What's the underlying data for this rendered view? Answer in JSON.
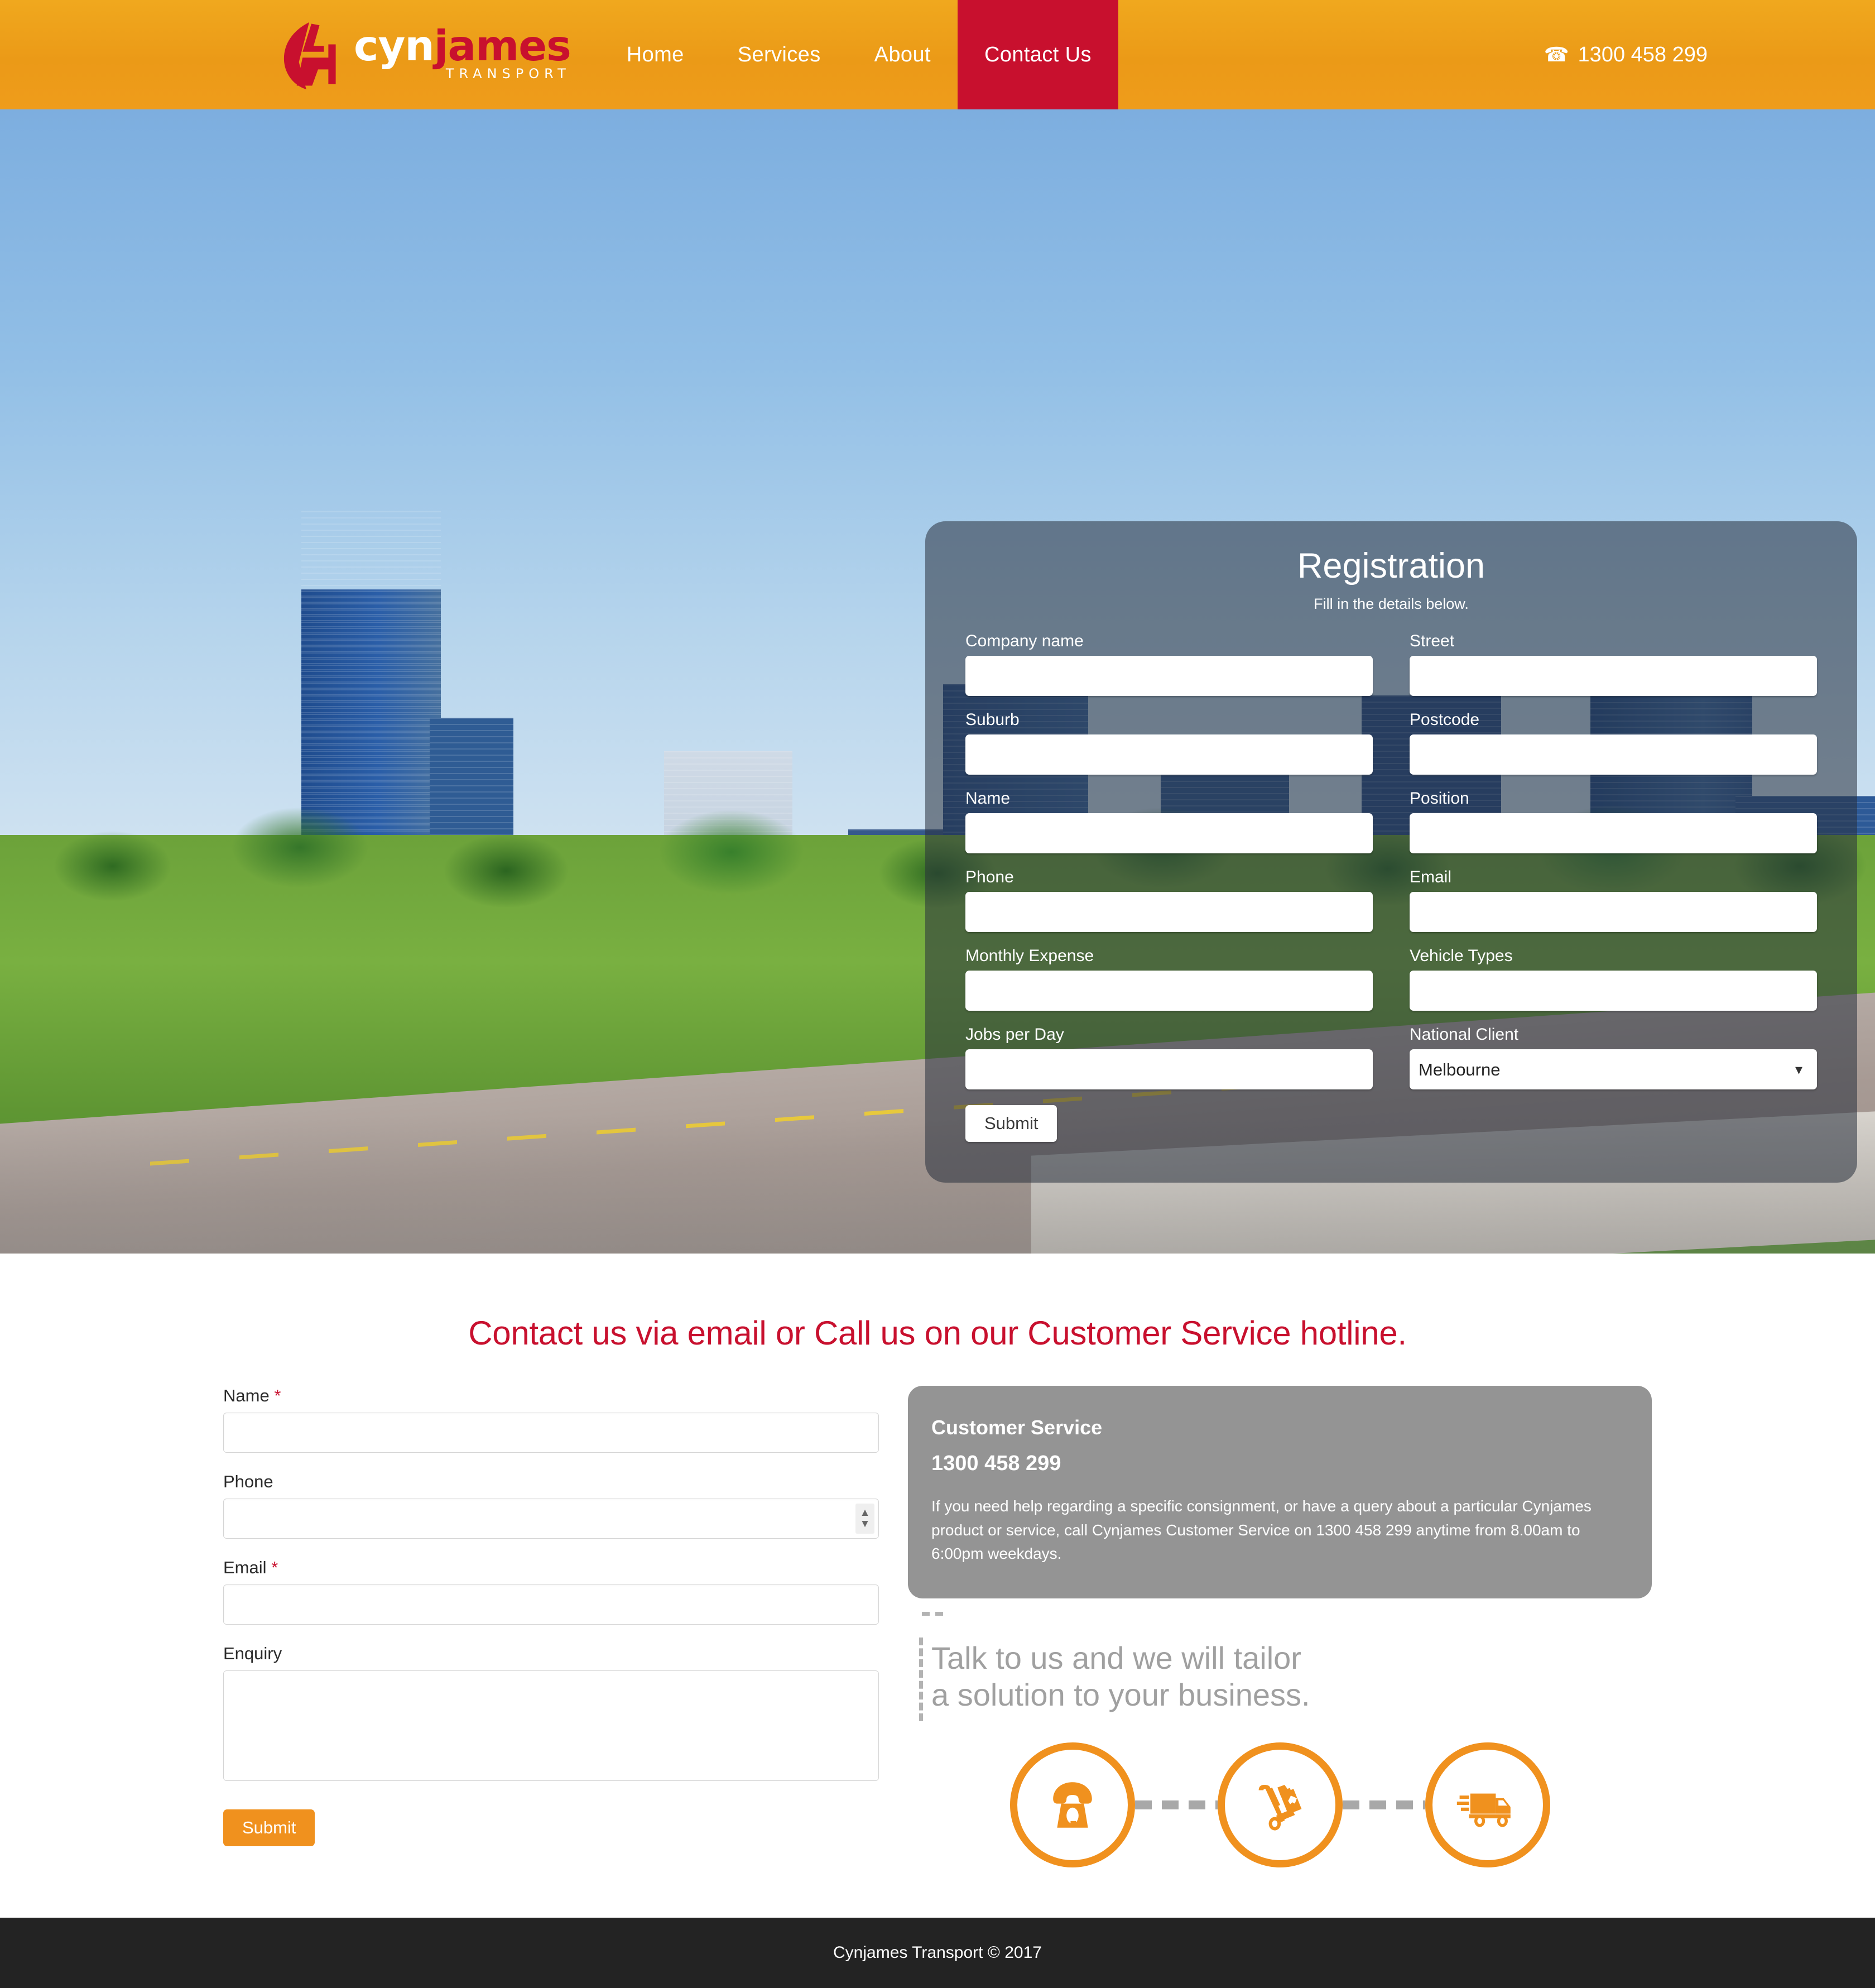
{
  "brand": {
    "logo_word_part1": "cyn",
    "logo_word_part2": "james",
    "logo_subtitle": "TRANSPORT",
    "accent_orange": "#ef9c1b",
    "accent_red": "#c8102e",
    "grey": "#949494"
  },
  "nav": {
    "items": [
      {
        "label": "Home",
        "active": false
      },
      {
        "label": "Services",
        "active": false
      },
      {
        "label": "About",
        "active": false
      },
      {
        "label": "Contact Us",
        "active": true
      }
    ],
    "phone": "1300 458 299",
    "phone_icon": "phone-icon"
  },
  "registration": {
    "title": "Registration",
    "subtitle": "Fill in the details below.",
    "fields": [
      {
        "label": "Company name",
        "value": "",
        "placeholder": "",
        "type": "text"
      },
      {
        "label": "Street",
        "value": "",
        "placeholder": "",
        "type": "text"
      },
      {
        "label": "Suburb",
        "value": "",
        "placeholder": "",
        "type": "text"
      },
      {
        "label": "Postcode",
        "value": "",
        "placeholder": "",
        "type": "text"
      },
      {
        "label": "Name",
        "value": "",
        "placeholder": "",
        "type": "text"
      },
      {
        "label": "Position",
        "value": "",
        "placeholder": "",
        "type": "text"
      },
      {
        "label": "Phone",
        "value": "",
        "placeholder": "",
        "type": "text"
      },
      {
        "label": "Email",
        "value": "",
        "placeholder": "",
        "type": "text"
      },
      {
        "label": "Monthly Expense",
        "value": "",
        "placeholder": "",
        "type": "text"
      },
      {
        "label": "Vehicle Types",
        "value": "",
        "placeholder": "",
        "type": "text"
      },
      {
        "label": "Jobs per Day",
        "value": "",
        "placeholder": "",
        "type": "text"
      },
      {
        "label": "National Client",
        "value": "Melbourne",
        "placeholder": "",
        "type": "select",
        "options": [
          "Melbourne"
        ]
      }
    ],
    "submit_label": "Submit"
  },
  "contact": {
    "heading": "Contact us via email or Call us on our Customer Service hotline.",
    "form": {
      "name_label": "Name",
      "name_required": "*",
      "name_value": "",
      "phone_label": "Phone",
      "phone_value": "",
      "email_label": "Email",
      "email_required": "*",
      "email_value": "",
      "enquiry_label": "Enquiry",
      "enquiry_value": "",
      "submit_label": "Submit"
    },
    "card": {
      "title": "Customer Service",
      "phone": "1300 458 299",
      "text": "If you need help regarding a specific consignment, or have a query about a particular Cynjames product or service, call Cynjames Customer Service on 1300 458 299 anytime from 8.00am to 6:00pm weekdays."
    },
    "tagline_line1": "Talk to us and we will tailor",
    "tagline_line2": "a solution to your business.",
    "icons": [
      {
        "name": "rotary-phone-icon"
      },
      {
        "name": "hand-truck-package-icon"
      },
      {
        "name": "delivery-truck-icon"
      }
    ]
  },
  "footer": {
    "copyright": "Cynjames Transport © 2017"
  }
}
